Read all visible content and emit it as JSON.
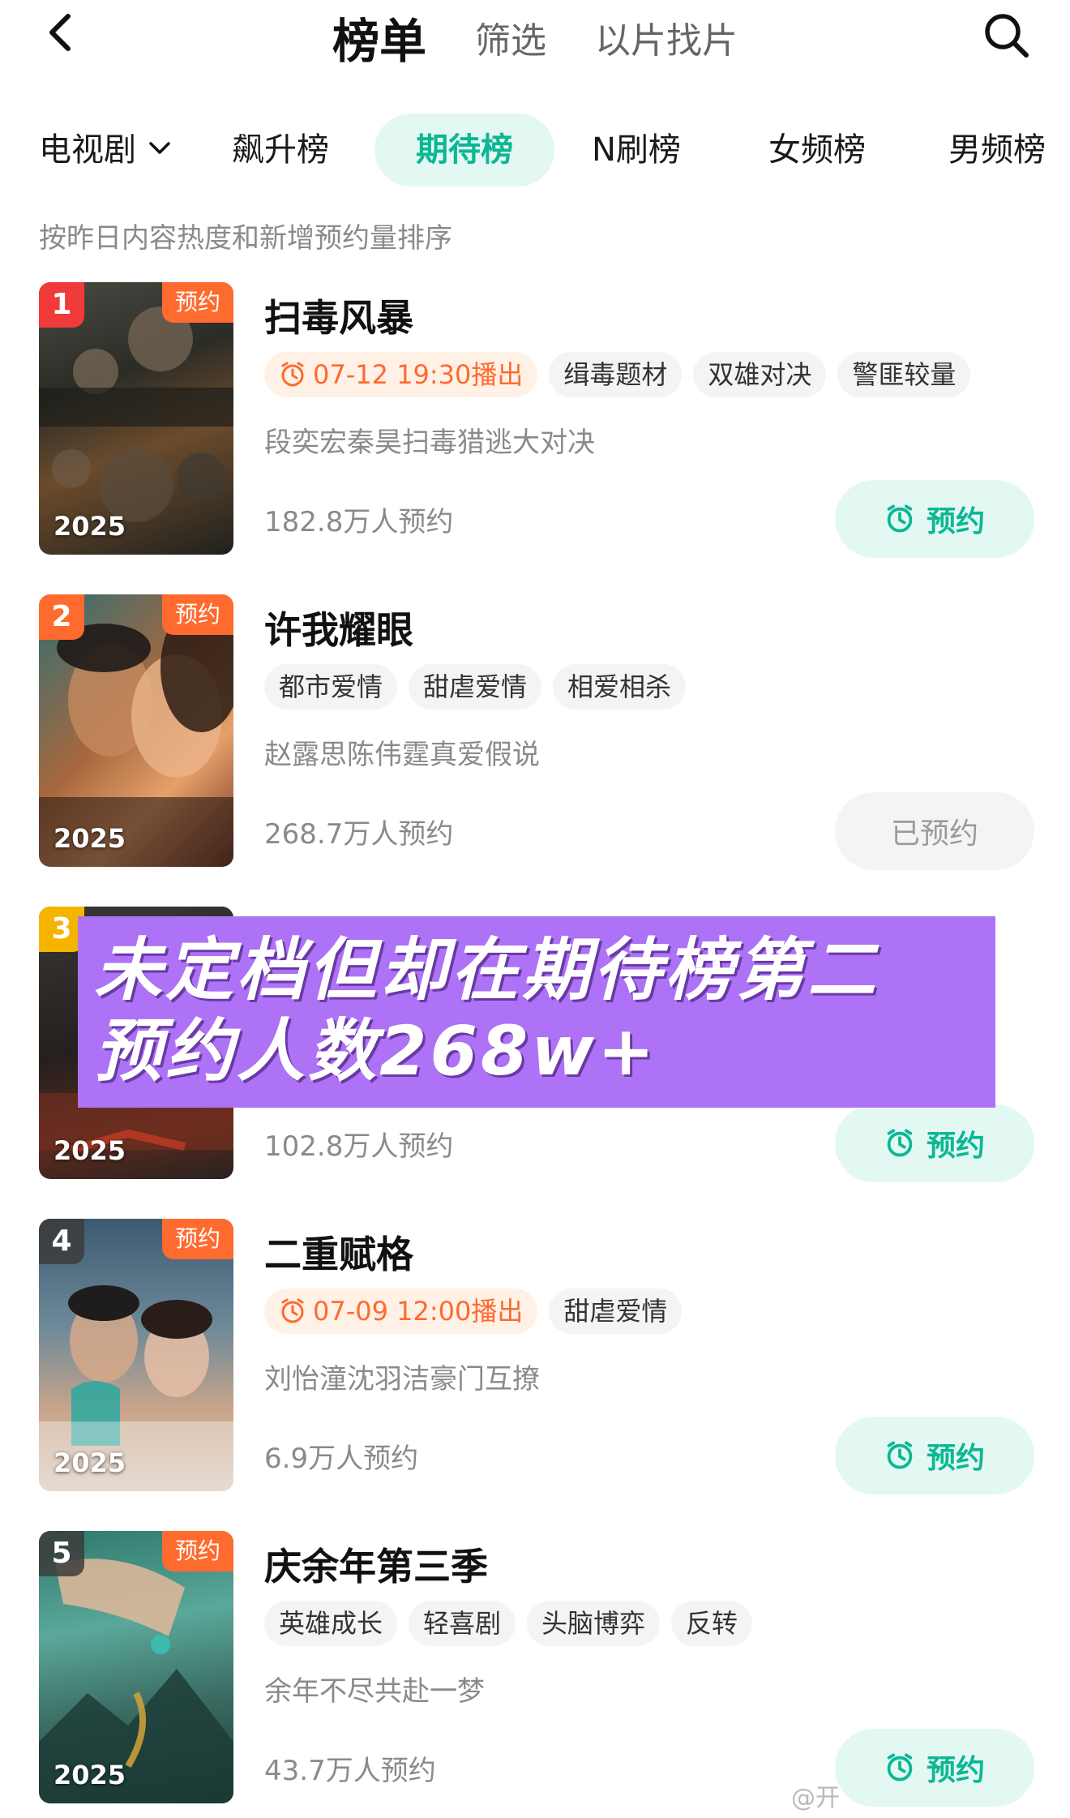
{
  "nav": {
    "tabs": [
      {
        "label": "榜单",
        "active": true
      },
      {
        "label": "筛选",
        "active": false
      },
      {
        "label": "以片找片",
        "active": false
      }
    ]
  },
  "categories": {
    "dropdown": "电视剧",
    "items": [
      "飙升榜",
      "期待榜",
      "N刷榜",
      "女频榜",
      "男频榜"
    ],
    "active": "期待榜"
  },
  "subtitle": "按昨日内容热度和新增预约量排序",
  "items": [
    {
      "rank": "1",
      "badge": "预约",
      "year": "2025",
      "title": "扫毒风暴",
      "airtime": "07-12 19:30播出",
      "tags": [
        "缉毒题材",
        "双雄对决",
        "警匪较量"
      ],
      "desc": "段奕宏秦昊扫毒猎逃大对决",
      "count": "182.8万人预约",
      "button": "预约",
      "reserved": false
    },
    {
      "rank": "2",
      "badge": "预约",
      "year": "2025",
      "title": "许我耀眼",
      "airtime": "",
      "tags": [
        "都市爱情",
        "甜虐爱情",
        "相爱相杀"
      ],
      "desc": "赵露思陈伟霆真爱假说",
      "count": "268.7万人预约",
      "button": "已预约",
      "reserved": true
    },
    {
      "rank": "3",
      "badge": "",
      "year": "2025",
      "title": "",
      "airtime": "",
      "tags": [],
      "desc": "",
      "count": "102.8万人预约",
      "button": "预约",
      "reserved": false
    },
    {
      "rank": "4",
      "badge": "预约",
      "year": "2025",
      "title": "二重赋格",
      "airtime": "07-09 12:00播出",
      "tags": [
        "甜虐爱情"
      ],
      "desc": "刘怡潼沈羽洁豪门互撩",
      "count": "6.9万人预约",
      "button": "预约",
      "reserved": false
    },
    {
      "rank": "5",
      "badge": "预约",
      "year": "2025",
      "title": "庆余年第三季",
      "airtime": "",
      "tags": [
        "英雄成长",
        "轻喜剧",
        "头脑博弈",
        "反转"
      ],
      "desc": "余年不尽共赴一梦",
      "count": "43.7万人预约",
      "button": "预约",
      "reserved": false
    }
  ],
  "overlay": {
    "line1": "未定档但却在期待榜第二",
    "line2": "预约人数268w+"
  },
  "watermark": "@开",
  "colors": {
    "accent": "#0bb794",
    "accent_bg": "#e4f8f3",
    "orange": "#ff6a2e",
    "overlay": "#ad72f5"
  }
}
